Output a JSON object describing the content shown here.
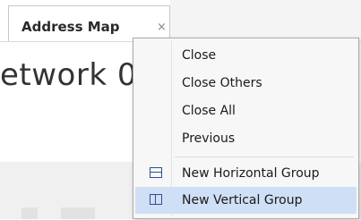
{
  "tab": {
    "title": "Address Map",
    "close_glyph": "×"
  },
  "content": {
    "title_fragment": "etwork 0"
  },
  "context_menu": {
    "items": [
      {
        "label": "Close",
        "icon": ""
      },
      {
        "label": "Close Others",
        "icon": ""
      },
      {
        "label": "Close All",
        "icon": ""
      },
      {
        "label": "Previous",
        "icon": ""
      },
      {
        "label": "New Horizontal Group",
        "icon": "horizontal-split-icon"
      },
      {
        "label": "New Vertical Group",
        "icon": "vertical-split-icon",
        "highlighted": true
      }
    ]
  },
  "colors": {
    "highlight": "#cfdff5",
    "icon": "#2f4f8f",
    "menu_bg": "#f7f7f7"
  }
}
